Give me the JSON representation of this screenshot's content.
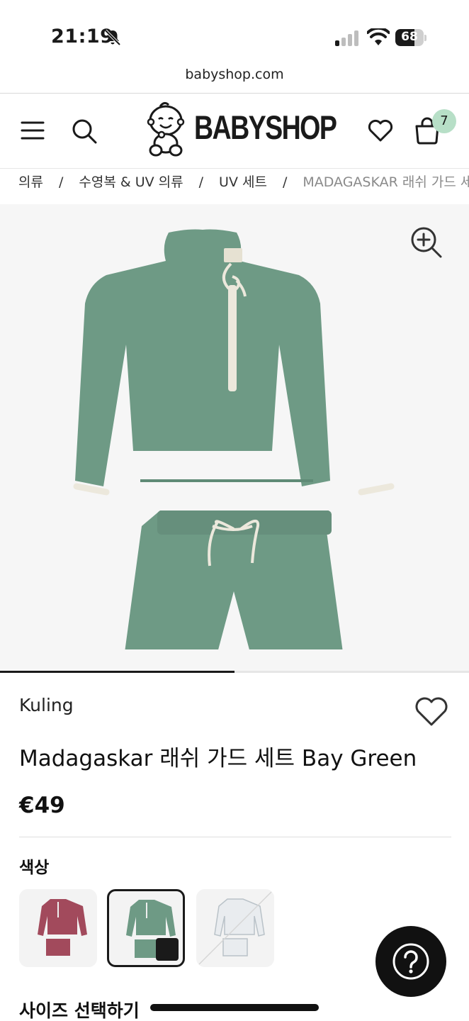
{
  "status_bar": {
    "time": "21:19",
    "battery": "68",
    "battery_level": 0.68
  },
  "browser": {
    "url": "babyshop.com"
  },
  "header": {
    "logo_text": "BABYSHOP",
    "cart_count": "7"
  },
  "breadcrumb": {
    "items": [
      "의류",
      "수영복 & UV 의류",
      "UV 세트",
      "MADAGASKAR 래쉬 가드 세트"
    ],
    "separator": "/"
  },
  "gallery": {
    "progress": 0.5,
    "garment_color": "#6e9a85",
    "trim_color": "#ece8dc"
  },
  "product": {
    "brand": "Kuling",
    "title": "Madagaskar 래쉬 가드 세트 Bay Green",
    "price": "€49",
    "color_label": "색상",
    "size_label": "사이즈 선택하기"
  },
  "swatches": [
    {
      "name": "red-stripe",
      "color": "#a24a5c",
      "selected": false
    },
    {
      "name": "bay-green",
      "color": "#6e9a85",
      "selected": true
    },
    {
      "name": "white-stripe",
      "color": "#e9ecef",
      "selected": false,
      "unavailable": true
    }
  ],
  "icons": {
    "menu": "menu-icon",
    "search": "search-icon",
    "wishlist": "heart-icon",
    "cart": "bag-icon",
    "zoom": "zoom-in-icon",
    "help": "question-icon"
  }
}
